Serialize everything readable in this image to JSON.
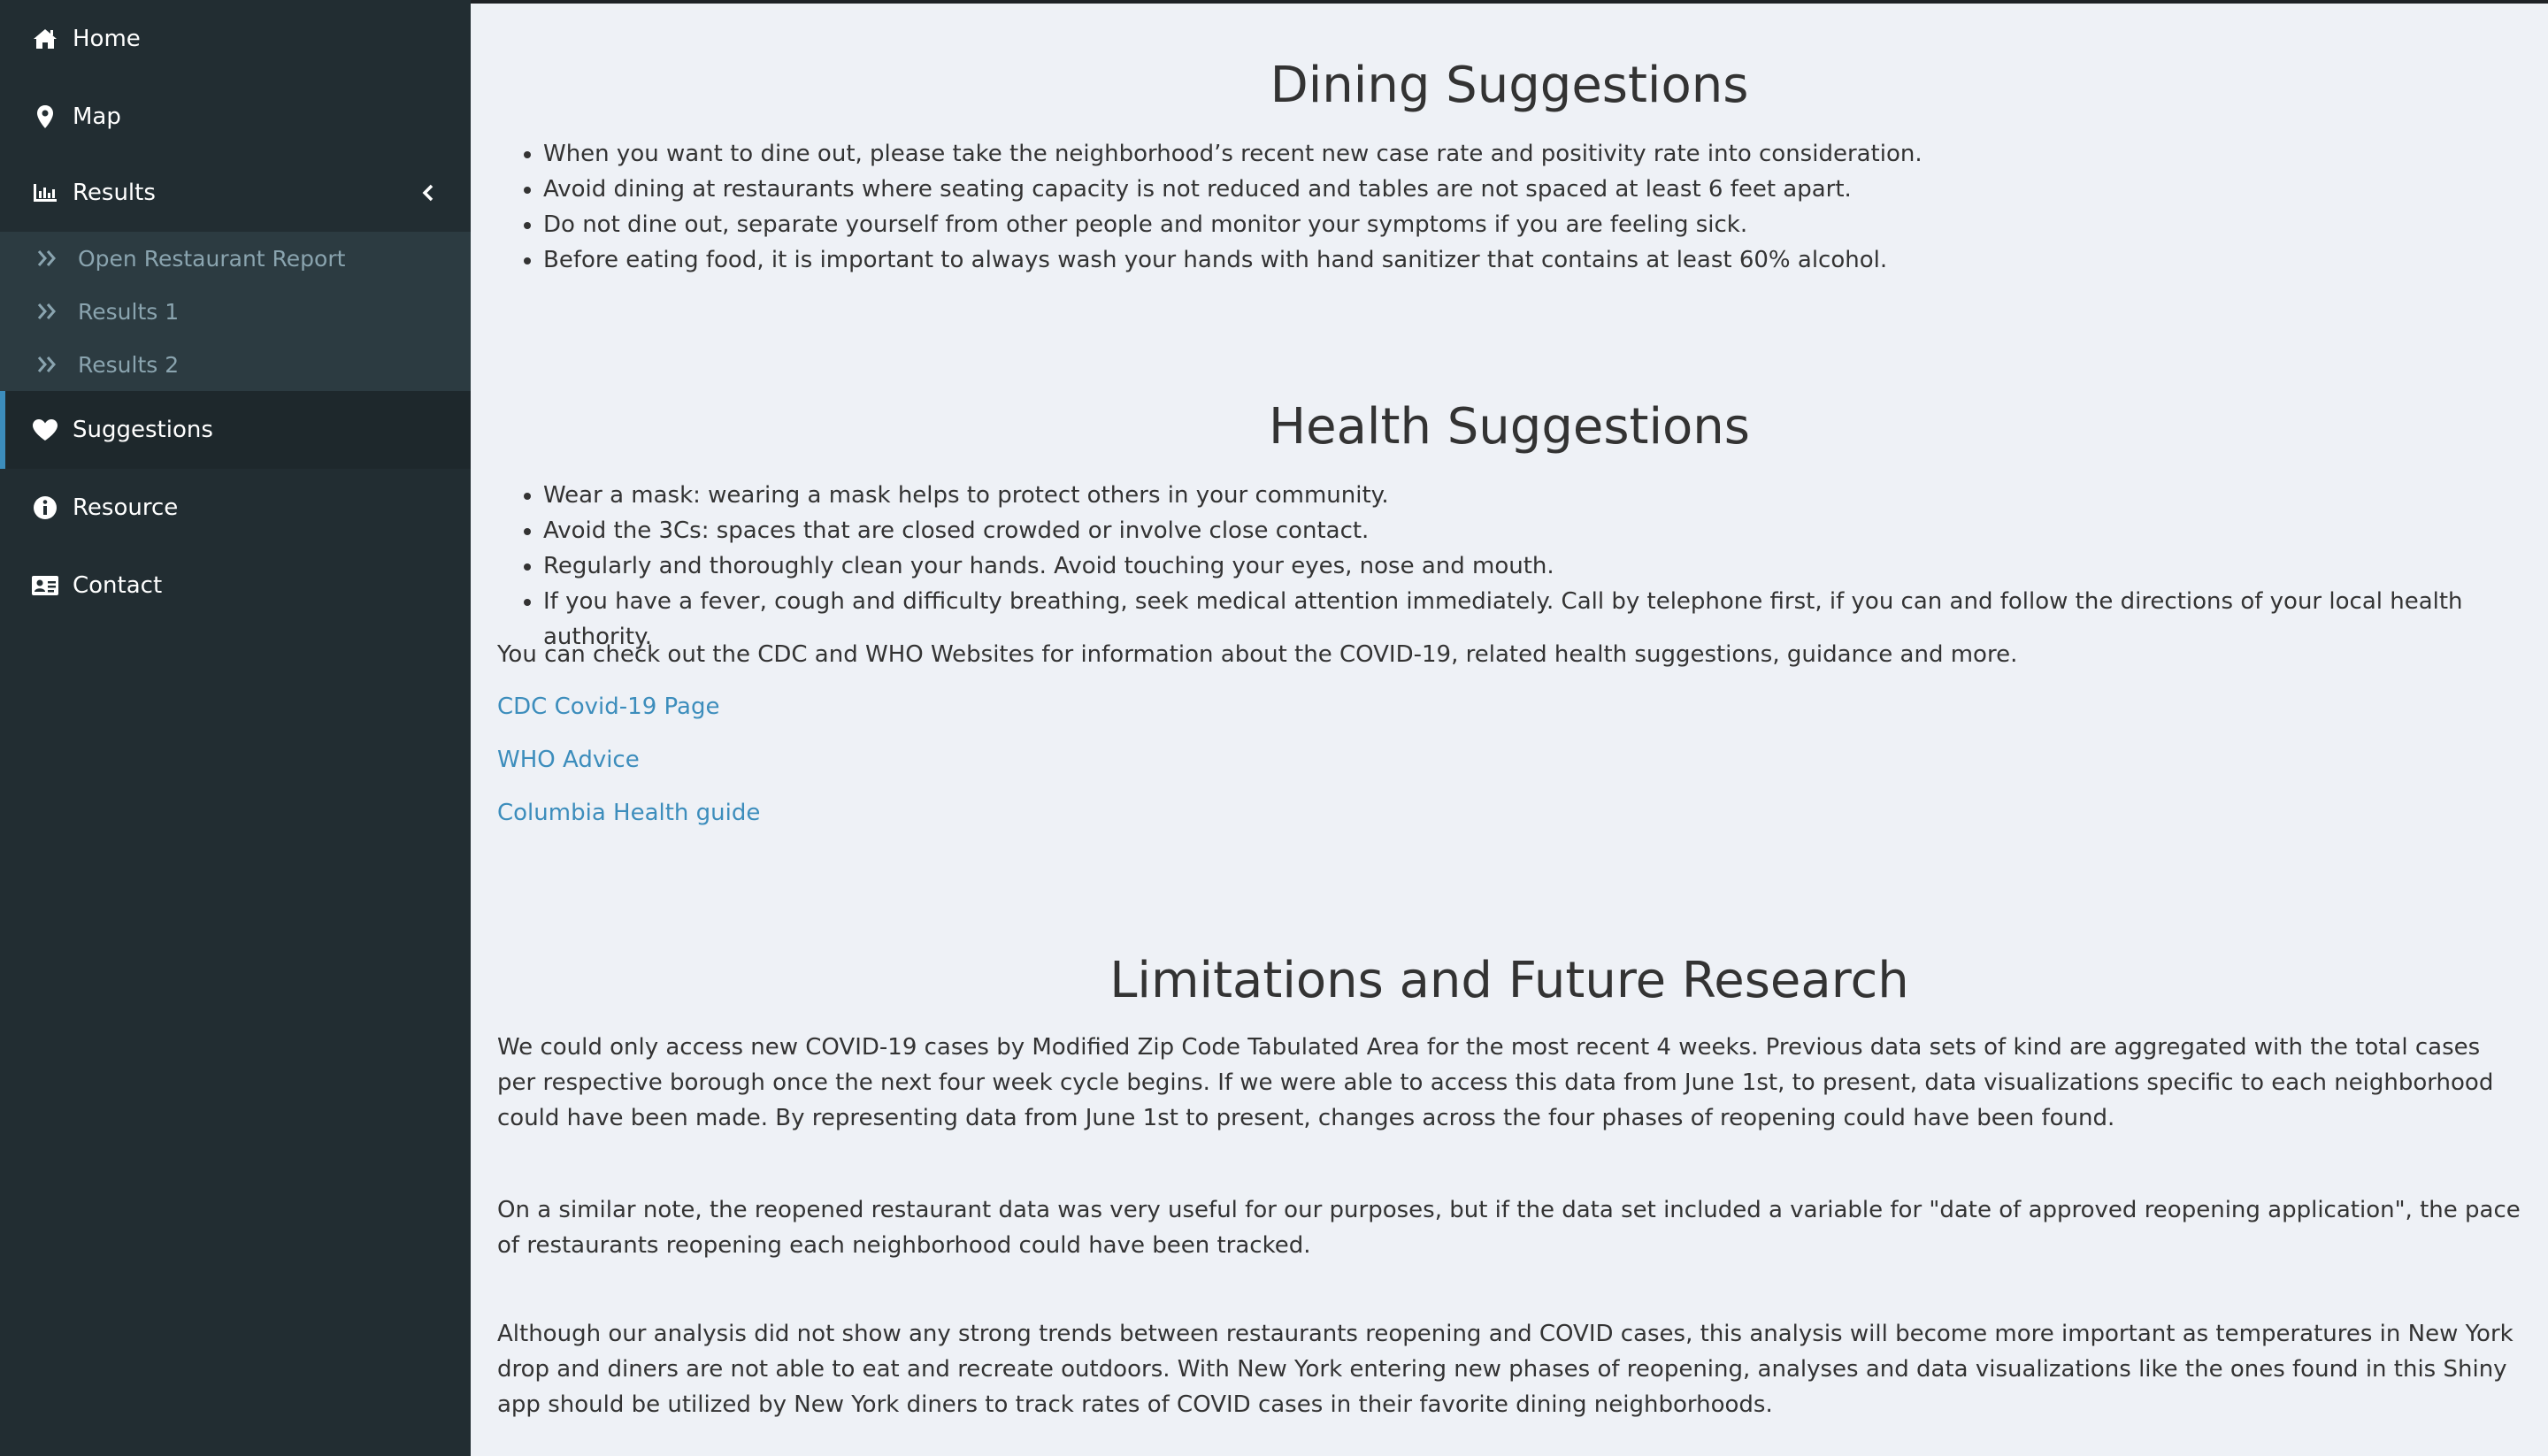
{
  "sidebar": {
    "items": [
      {
        "label": "Home",
        "icon": "home-icon"
      },
      {
        "label": "Map",
        "icon": "map-marker-icon"
      },
      {
        "label": "Results",
        "icon": "bar-chart-icon"
      },
      {
        "label": "Suggestions",
        "icon": "heart-icon"
      },
      {
        "label": "Resource",
        "icon": "info-circle-icon"
      },
      {
        "label": "Contact",
        "icon": "id-card-icon"
      }
    ],
    "results_submenu": [
      {
        "label": "Open Restaurant Report"
      },
      {
        "label": "Results 1"
      },
      {
        "label": "Results 2"
      }
    ],
    "active_item": "Suggestions"
  },
  "content": {
    "dining": {
      "title": "Dining Suggestions",
      "bullets": [
        "When you want to dine out, please take the neighborhood’s recent new case rate and positivity rate into consideration.",
        "Avoid dining at restaurants where seating capacity is not reduced and tables are not spaced at least 6 feet apart.",
        "Do not dine out, separate yourself from other people and monitor your symptoms if you are feeling sick.",
        "Before eating food, it is important to always wash your hands with hand sanitizer that contains at least 60% alcohol."
      ]
    },
    "health": {
      "title": "Health Suggestions",
      "bullets": [
        "Wear a mask: wearing a mask helps to protect others in your community.",
        "Avoid the 3Cs: spaces that are closed crowded or involve close contact.",
        "Regularly and thoroughly clean your hands. Avoid touching your eyes, nose and mouth.",
        "If you have a fever, cough and difficulty breathing, seek medical attention immediately. Call by telephone first, if you can and follow the directions of your local health authority."
      ],
      "note": "You can check out the CDC and WHO Websites for information about the COVID-19, related health suggestions, guidance and more.",
      "links": [
        {
          "label": "CDC Covid-19 Page"
        },
        {
          "label": "WHO Advice"
        },
        {
          "label": "Columbia Health guide"
        }
      ]
    },
    "limitations": {
      "title": "Limitations and Future Research",
      "paragraphs": [
        "We could only access new COVID-19 cases by Modified Zip Code Tabulated Area for the most recent 4 weeks. Previous data sets of kind are aggregated with the total cases per respective borough once the next four week cycle begins. If we were able to access this data from June 1st, to present, data visualizations specific to each neighborhood could have been made. By representing data from June 1st to present, changes across the four phases of reopening could have been found.",
        "On a similar note, the reopened restaurant data was very useful for our purposes, but if the data set included a variable for \"date of approved reopening application\", the pace of restaurants reopening each neighborhood could have been tracked.",
        "Although our analysis did not show any strong trends between restaurants reopening and COVID cases, this analysis will become more important as temperatures in New York drop and diners are not able to eat and recreate outdoors. With New York entering new phases of reopening, analyses and data visualizations like the ones found in this Shiny app should be utilized by New York diners to track rates of COVID cases in their favorite dining neighborhoods."
      ]
    }
  },
  "colors": {
    "sidebar_bg": "#222d32",
    "submenu_bg": "#2c3b41",
    "active_bg": "#1e282c",
    "accent": "#3c8dbc",
    "content_bg": "#eef1f6"
  }
}
